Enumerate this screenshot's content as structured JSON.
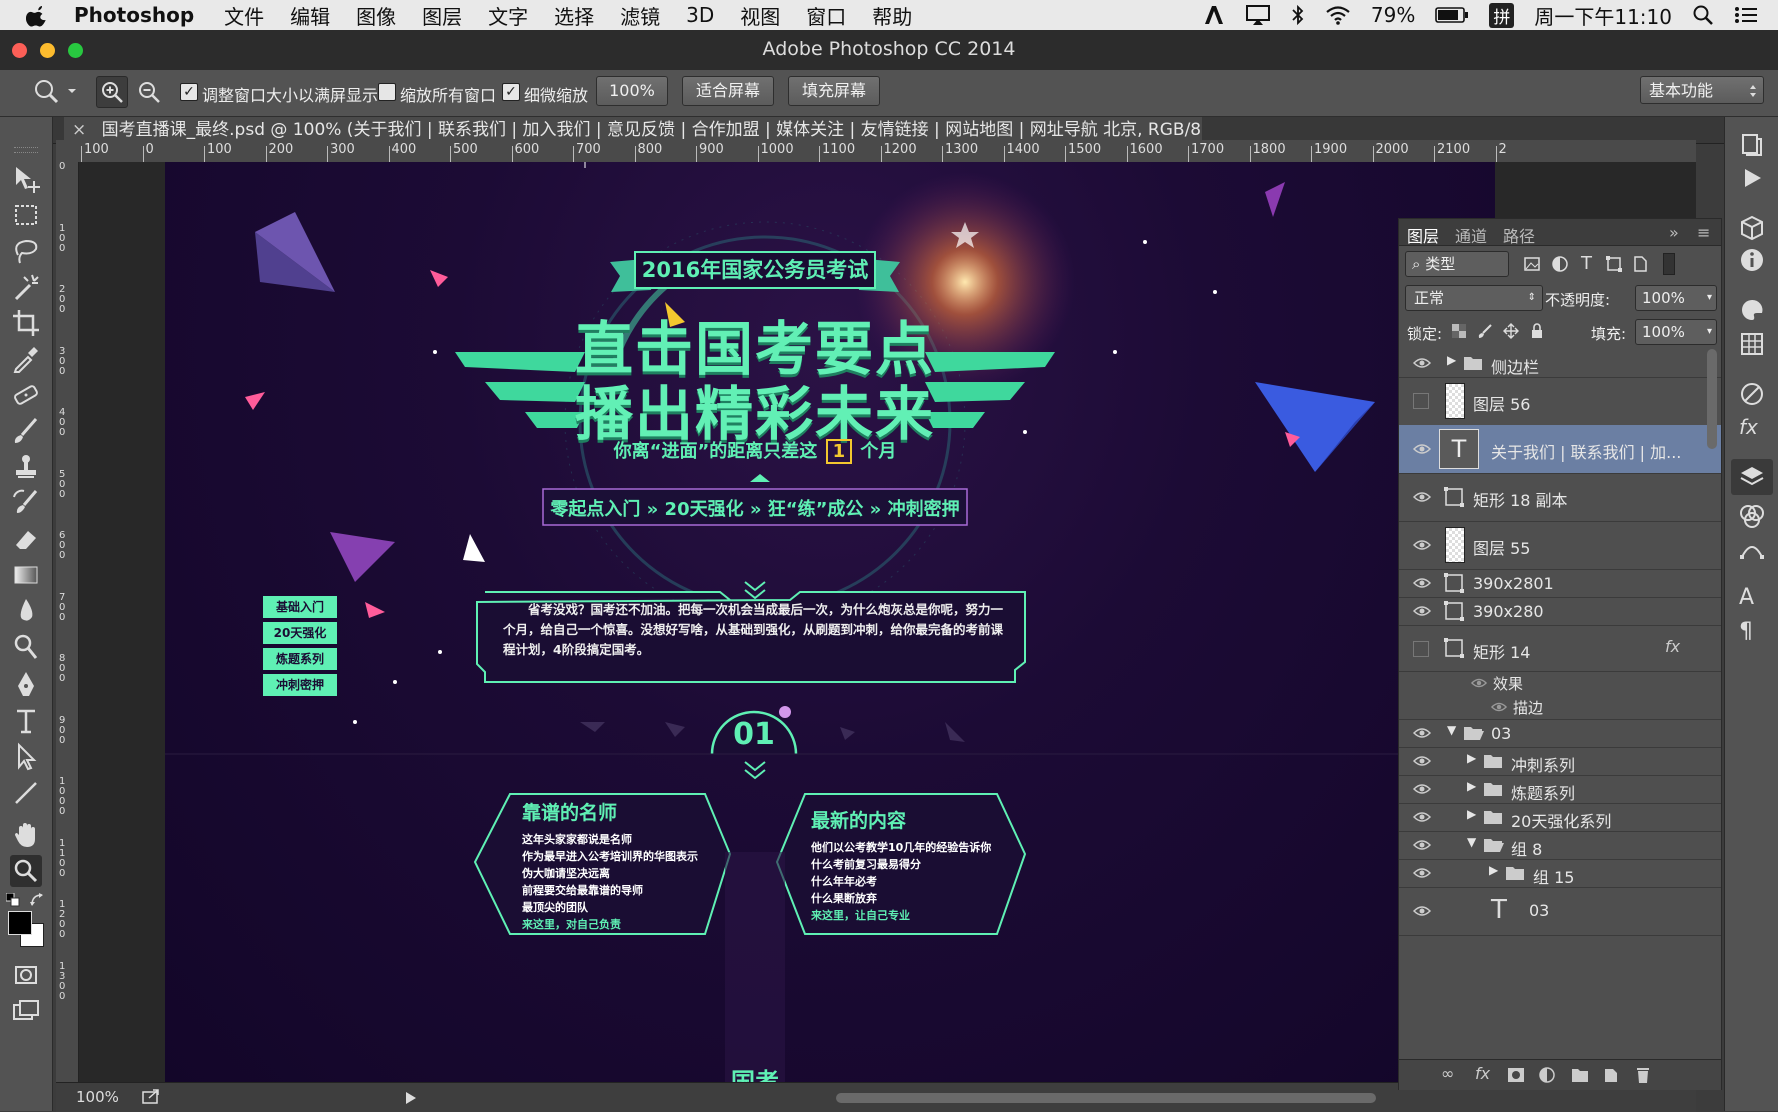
{
  "menubar": {
    "app": "Photoshop",
    "items": [
      "文件",
      "编辑",
      "图像",
      "图层",
      "文字",
      "选择",
      "滤镜",
      "3D",
      "视图",
      "窗口",
      "帮助"
    ],
    "battery": "79%",
    "clock": "周一下午11:10",
    "input_method": "拼"
  },
  "window": {
    "title": "Adobe Photoshop CC 2014"
  },
  "options": {
    "resize_label": "调整窗口大小以满屏显示",
    "zoom_all_label": "缩放所有窗口",
    "scrubby_label": "细微缩放",
    "pct_button": "100%",
    "fit_button": "适合屏幕",
    "fill_button": "填充屏幕",
    "workspace": "基本功能"
  },
  "document": {
    "tab_title": "国考直播课_最终.psd @ 100% (关于我们 | 联系我们 | 加入我们 | 意见反馈 | 合作加盟 | 媒体关注 | 友情链接 | 网站地图 | 网址导航 北京, RGB/8#)",
    "close": "×"
  },
  "ruler": {
    "h_labels": [
      "100",
      "0",
      "100",
      "200",
      "300",
      "400",
      "500",
      "600",
      "700",
      "800",
      "900",
      "1000",
      "1100",
      "1200",
      "1300",
      "1400",
      "1500",
      "1600",
      "1700",
      "1800",
      "1900",
      "2000",
      "2100",
      "2"
    ],
    "v_labels": [
      "0",
      "100",
      "200",
      "300",
      "400",
      "500",
      "600",
      "700",
      "800",
      "900",
      "1000",
      "1100",
      "1200",
      "1300"
    ]
  },
  "artwork": {
    "banner": "2016年国家公务员考试",
    "headline1": "直击国考要点",
    "headline2": "播出精彩未来",
    "sub": "你离“进面”的距离只差这",
    "sub_num": "1",
    "sub_tail": "个月",
    "steps": "零起点入门 » 20天强化 » 狂“练”成公 » 冲刺密押",
    "side_buttons": [
      "基础入门",
      "20天强化",
      "炼题系列",
      "冲刺密押"
    ],
    "intro": "省考没戏？国考还不加油。把每一次机会当成最后一次，为什么炮灰总是你呢，努力一个月，给自己一个惊喜。没想好写啥，从基础到强化，从刷题到冲刺，给你最完备的考前课程计划，4阶段搞定国考。",
    "section_num": "01",
    "card1_title": "靠谱的名师",
    "card1_lines": [
      "这年头家家都说是名师",
      "作为最早进入公考培训界的华图表示",
      "伪大咖请坚决远离",
      "前程要交给最靠谱的导师",
      "最顶尖的团队"
    ],
    "card1_tail": "来这里，对自己负责",
    "card2_title": "最新的内容",
    "card2_lines": [
      "他们以公考教学10几年的经验告诉你",
      "什么考前复习最易得分",
      "什么年年必考",
      "什么果断放弃"
    ],
    "card2_tail": "来这里，让自己专业",
    "bottom_text": "国考"
  },
  "status": {
    "zoom": "100%"
  },
  "layers": {
    "tabs": [
      "图层",
      "通道",
      "路径"
    ],
    "filter": "类型",
    "blend": "正常",
    "opacity_label": "不透明度:",
    "opacity": "100%",
    "lock_label": "锁定:",
    "fill_label": "填充:",
    "fill": "100%",
    "rows": [
      {
        "name": "侧边栏"
      },
      {
        "name": "图层 56"
      },
      {
        "name": "关于我们 | 联系我们 | 加..."
      },
      {
        "name": "矩形 18 副本"
      },
      {
        "name": "图层 55"
      },
      {
        "name": "390x2801"
      },
      {
        "name": "390x280"
      },
      {
        "name": "矩形 14"
      },
      {
        "name": "效果"
      },
      {
        "name": "描边"
      },
      {
        "name": "03"
      },
      {
        "name": "冲刺系列"
      },
      {
        "name": "炼题系列"
      },
      {
        "name": "20天强化系列"
      },
      {
        "name": "组 8"
      },
      {
        "name": "组 15"
      },
      {
        "name": "03"
      }
    ],
    "fx": "fx",
    "T": "T"
  },
  "colors": {
    "mint": "#5ff0b4",
    "selection": "#6b7fa3",
    "canvas_bg": "#1c0b35"
  }
}
